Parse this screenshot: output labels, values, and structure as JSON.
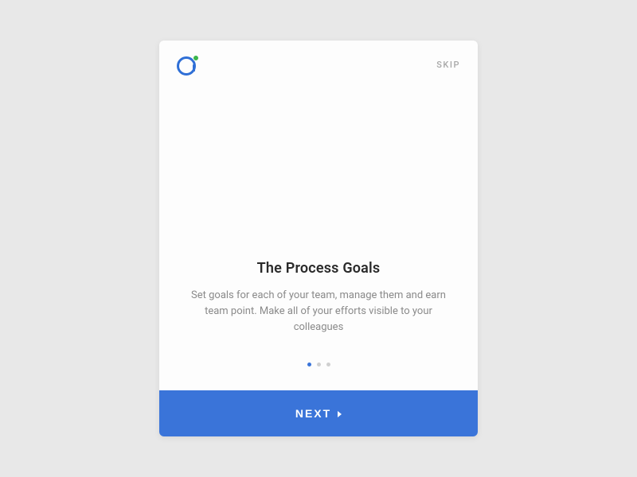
{
  "header": {
    "skip_label": "SKIP"
  },
  "content": {
    "title": "The Process Goals",
    "description": "Set goals for each of your team, manage them and earn team point. Make all of your efforts visible to your colleagues"
  },
  "pagination": {
    "total": 3,
    "active_index": 0
  },
  "footer": {
    "next_label": "NEXT"
  },
  "colors": {
    "primary": "#3a74d9",
    "accent": "#3bb54a"
  }
}
